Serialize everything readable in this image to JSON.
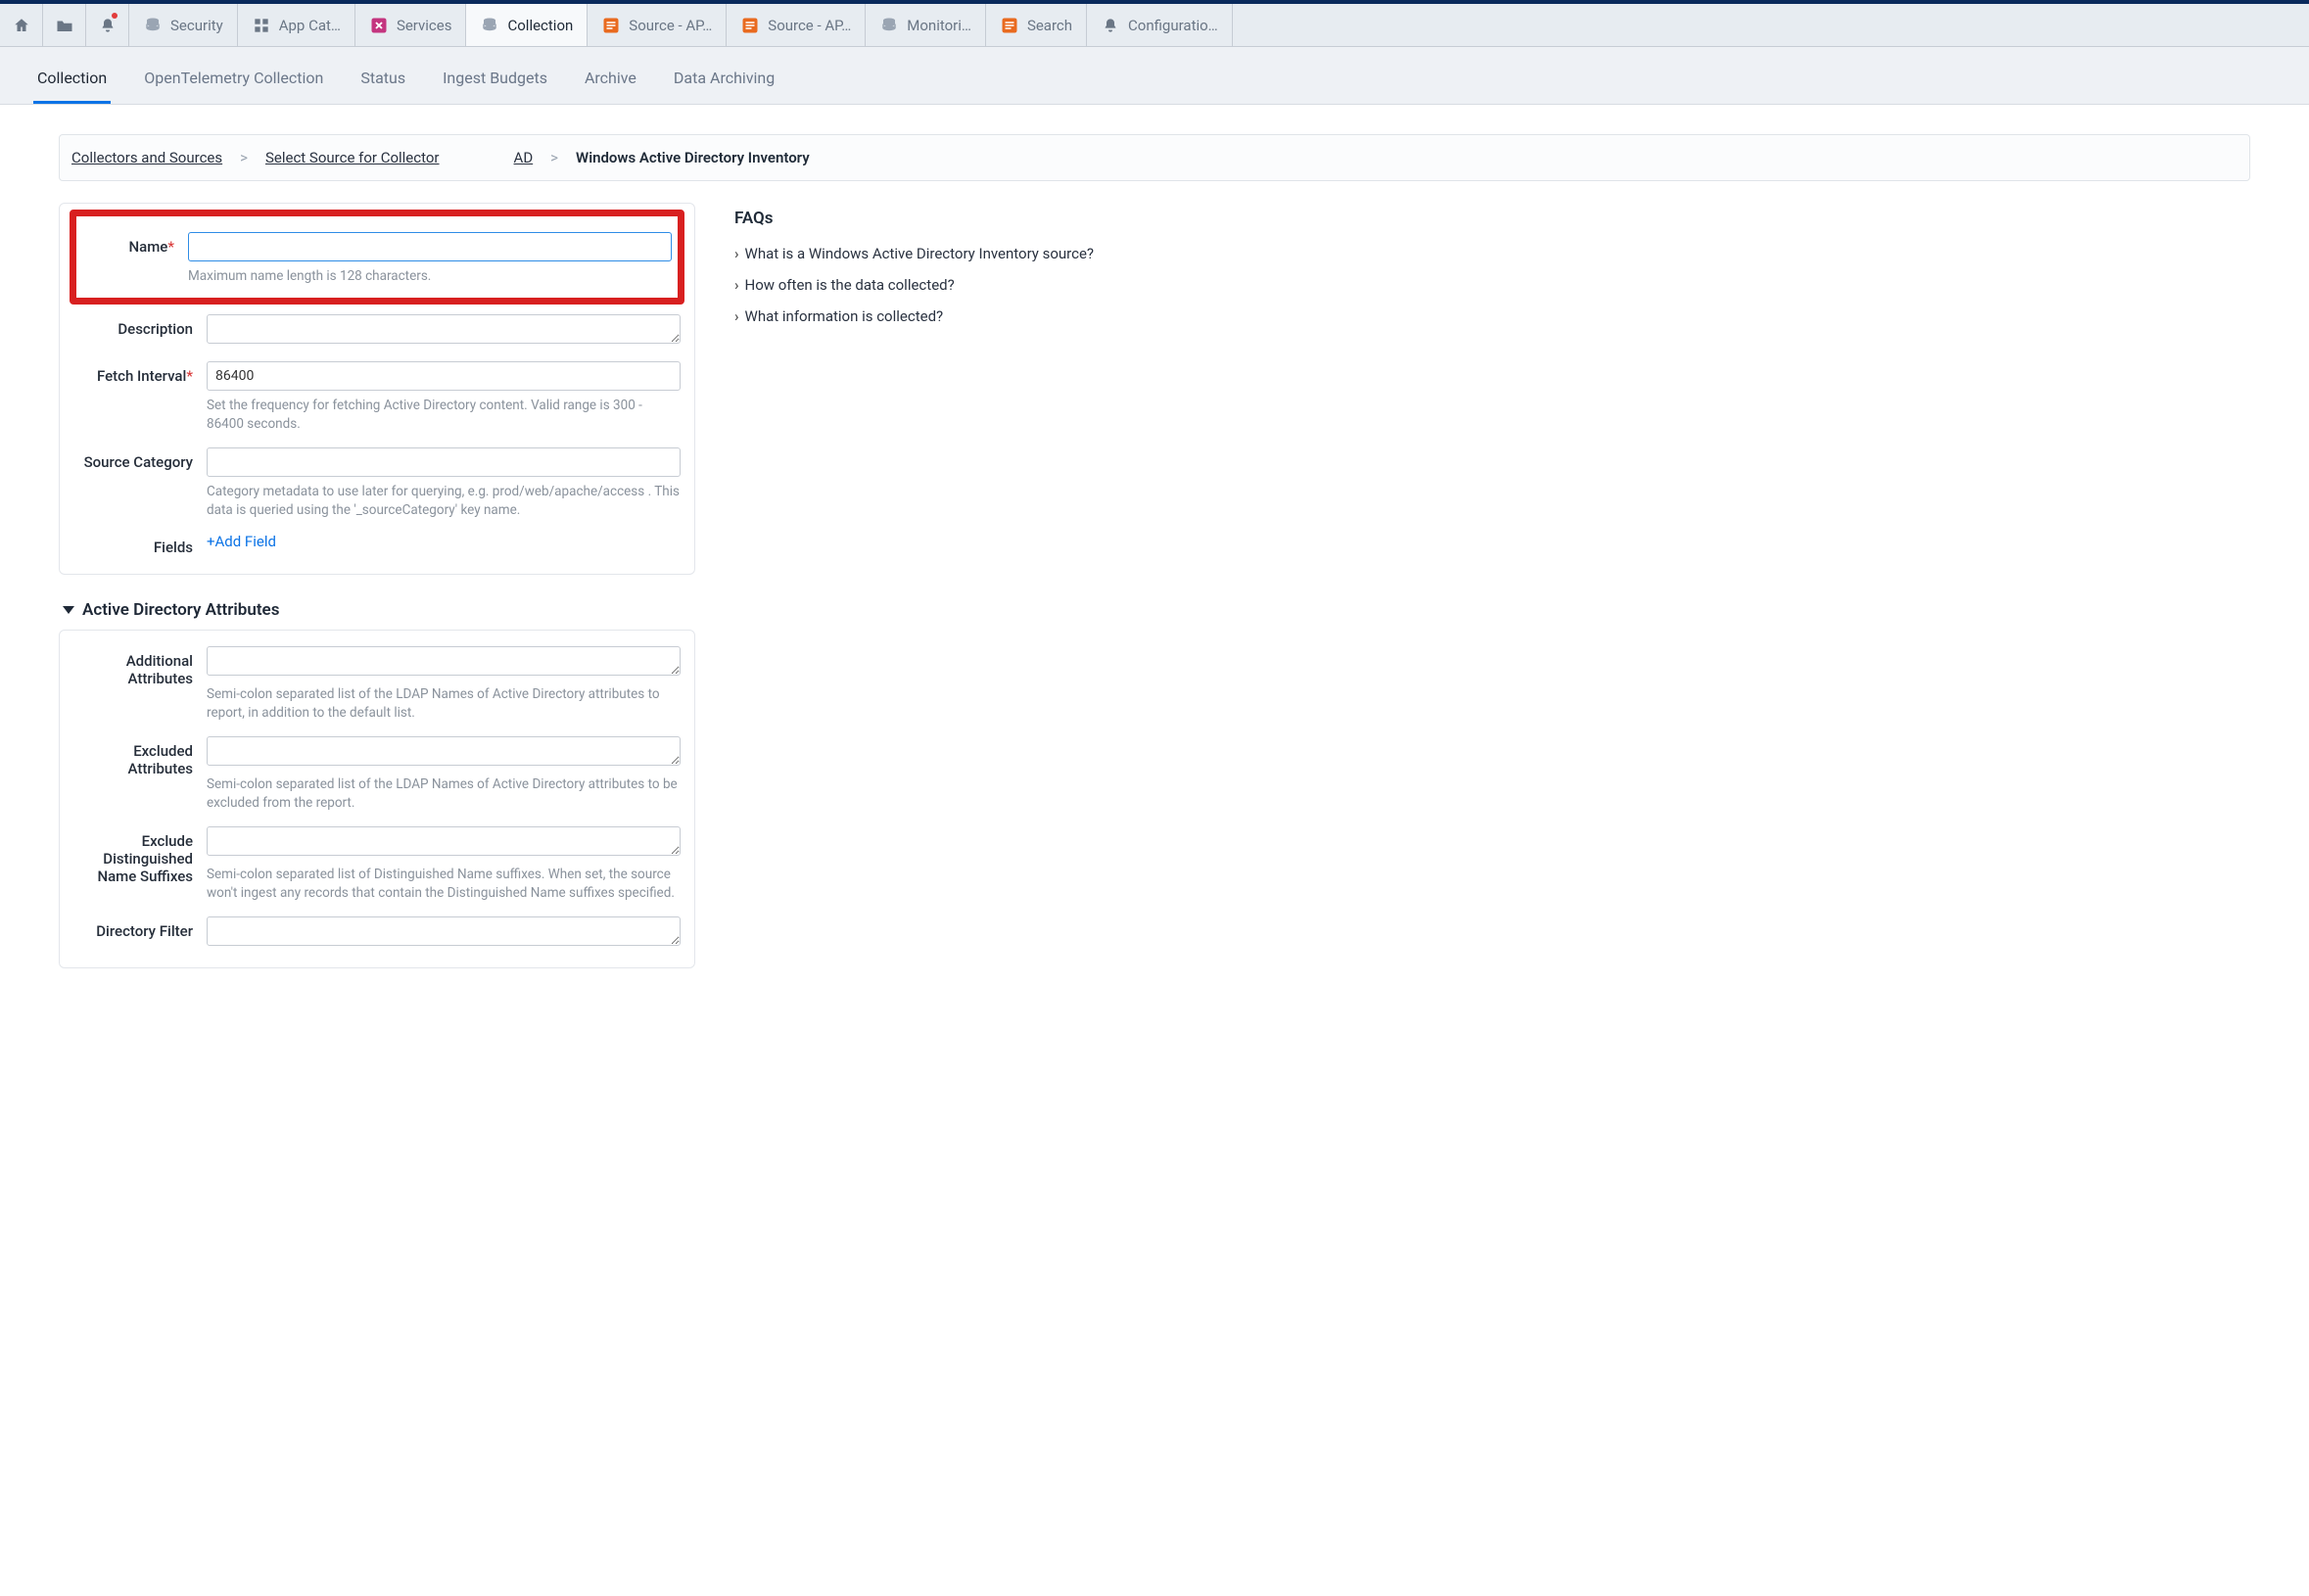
{
  "topTabs": [
    {
      "label": "",
      "icon": "home"
    },
    {
      "label": "",
      "icon": "folder"
    },
    {
      "label": "",
      "icon": "bell-dot"
    },
    {
      "label": "Security",
      "icon": "db-gray"
    },
    {
      "label": "App Cat…",
      "icon": "grid"
    },
    {
      "label": "Services",
      "icon": "services"
    },
    {
      "label": "Collection",
      "icon": "db-gray",
      "active": true
    },
    {
      "label": "Source - AP…",
      "icon": "doc-orange"
    },
    {
      "label": "Source - AP…",
      "icon": "doc-orange"
    },
    {
      "label": "Monitori…",
      "icon": "db-gray"
    },
    {
      "label": "Search",
      "icon": "doc-orange"
    },
    {
      "label": "Configuratio…",
      "icon": "bell-gray"
    }
  ],
  "subNav": {
    "items": [
      "Collection",
      "OpenTelemetry Collection",
      "Status",
      "Ingest Budgets",
      "Archive",
      "Data Archiving"
    ],
    "activeIndex": 0
  },
  "breadcrumb": {
    "links": [
      "Collectors and Sources",
      "Select Source for Collector",
      "AD"
    ],
    "current": "Windows Active Directory Inventory"
  },
  "form": {
    "name": {
      "label": "Name",
      "required": true,
      "value": "",
      "helper": "Maximum name length is 128 characters."
    },
    "description": {
      "label": "Description",
      "value": ""
    },
    "fetchInterval": {
      "label": "Fetch Interval",
      "required": true,
      "value": "86400",
      "helper": "Set the frequency for fetching Active Directory content. Valid range is 300 - 86400 seconds."
    },
    "sourceCategory": {
      "label": "Source Category",
      "value": "",
      "helper": "Category metadata to use later for querying, e.g. prod/web/apache/access . This data is queried using the '_sourceCategory' key name."
    },
    "fields": {
      "label": "Fields",
      "addLabel": "+Add Field"
    }
  },
  "adSection": {
    "title": "Active Directory Attributes",
    "additional": {
      "label": "Additional Attributes",
      "value": "",
      "helper": "Semi-colon separated list of the LDAP Names of Active Directory attributes to report, in addition to the default list."
    },
    "excluded": {
      "label": "Excluded Attributes",
      "value": "",
      "helper": "Semi-colon separated list of the LDAP Names of Active Directory attributes to be excluded from the report."
    },
    "dnSuffixes": {
      "label": "Exclude Distinguished Name Suffixes",
      "value": "",
      "helper": "Semi-colon separated list of Distinguished Name suffixes. When set, the source won't ingest any records that contain the Distinguished Name suffixes specified."
    },
    "dirFilter": {
      "label": "Directory Filter",
      "value": ""
    }
  },
  "faq": {
    "title": "FAQs",
    "items": [
      "What is a Windows Active Directory Inventory source?",
      "How often is the data collected?",
      "What information is collected?"
    ]
  }
}
